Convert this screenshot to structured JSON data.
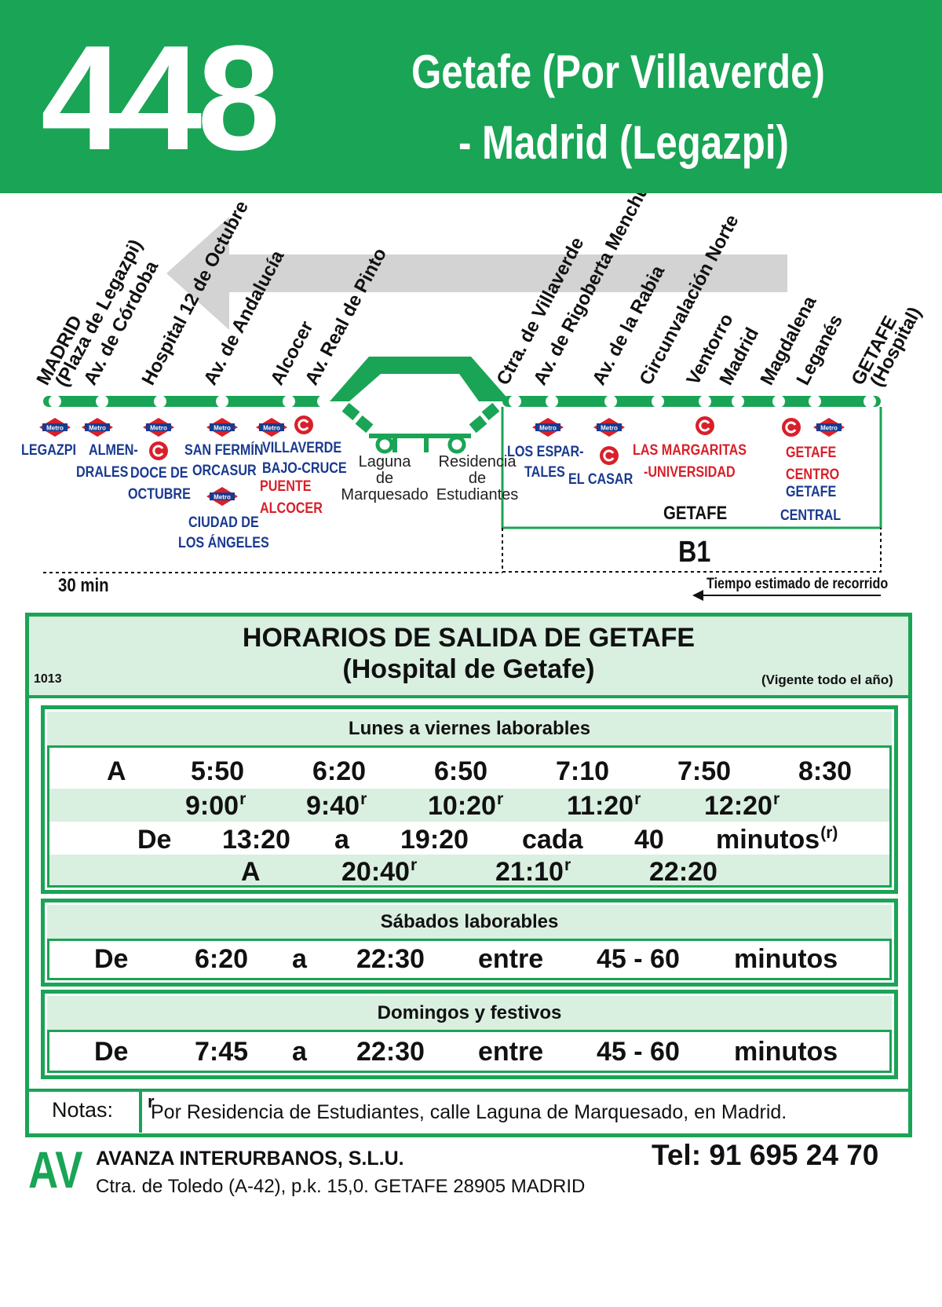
{
  "header": {
    "route_number": "448",
    "route_name_line1": "Getafe (Por Villaverde)",
    "route_name_line2": "- Madrid (Legazpi)"
  },
  "map": {
    "stops": [
      {
        "label": "MADRID",
        "sub": "(Plaza de Legazpi)"
      },
      {
        "label": "Av. de Córdoba"
      },
      {
        "label": "Hospital 12 de Octubre"
      },
      {
        "label": "Av. de Andalucía"
      },
      {
        "label": "Alcocer"
      },
      {
        "label": "Av. Real de Pinto"
      },
      {
        "label": "Ctra. de Villaverde"
      },
      {
        "label": "Av. de Rigoberta Menchú"
      },
      {
        "label": "Av. de la Rabia"
      },
      {
        "label": "Circunvalación Norte"
      },
      {
        "label": "Ventorro"
      },
      {
        "label": "Madrid"
      },
      {
        "label": "Magdalena"
      },
      {
        "label": "Leganés"
      },
      {
        "label": "GETAFE",
        "sub": "(Hospital)"
      }
    ],
    "connections": {
      "legazpi": "LEGAZPI",
      "almendrales_1": "ALMEN-",
      "almendrales_2": "DRALES",
      "doce_1": "DOCE DE",
      "doce_2": "OCTUBRE",
      "san_fermin_1": "SAN FERMÍN",
      "san_fermin_2": "ORCASUR",
      "ciudad_1": "CIUDAD DE",
      "ciudad_2": "LOS ÁNGELES",
      "villaverde_1": "VILLAVERDE",
      "villaverde_2": "BAJO-CRUCE",
      "puente_1": "PUENTE",
      "puente_2": "ALCOCER",
      "laguna": [
        "Laguna",
        "de",
        "Marquesado"
      ],
      "residencia": [
        "Residencia",
        "de",
        "Estudiantes"
      ],
      "espartales_1": "LOS ESPAR-",
      "espartales_2": "TALES",
      "el_casar": "EL CASAR",
      "margaritas_1": "LAS MARGARITAS",
      "margaritas_2": "-UNIVERSIDAD",
      "getafe_zone": "GETAFE",
      "getafe_centro_1": "GETAFE",
      "getafe_centro_2": "CENTRO",
      "getafe_central_1": "GETAFE",
      "getafe_central_2": "CENTRAL",
      "b1": "B1",
      "metro_badge": "Metro"
    },
    "travel_time": "30 min",
    "travel_time_caption": "Tiempo estimado de recorrido"
  },
  "schedule": {
    "title_line1": "HORARIOS DE SALIDA DE GETAFE",
    "title_line2": "(Hospital de Getafe)",
    "code": "1013",
    "validity": "(Vigente todo el año)",
    "weekdays": {
      "title": "Lunes a viernes laborables",
      "row1": [
        "A",
        "5:50",
        "6:20",
        "6:50",
        "7:10",
        "7:50",
        "8:30"
      ],
      "row2": [
        "9:00",
        "9:40",
        "10:20",
        "11:20",
        "12:20"
      ],
      "row3": [
        "De",
        "13:20",
        "a",
        "19:20",
        "cada",
        "40",
        "minutos"
      ],
      "row4": [
        "A",
        "20:40",
        "21:10",
        "22:20"
      ],
      "sup_r": "r",
      "sup_paren_r": "(r)"
    },
    "saturdays": {
      "title": "Sábados laborables",
      "row": [
        "De",
        "6:20",
        "a",
        "22:30",
        "entre",
        "45 - 60",
        "minutos"
      ]
    },
    "sundays": {
      "title": "Domingos y festivos",
      "row": [
        "De",
        "7:45",
        "a",
        "22:30",
        "entre",
        "45 - 60",
        "minutos"
      ]
    },
    "notes_label": "Notas:",
    "notes_mark": "r",
    "notes_text": "Por Residencia de Estudiantes, calle Laguna de Marquesado, en Madrid."
  },
  "footer": {
    "logo": "AV",
    "company": "AVANZA INTERURBANOS, S.L.U.",
    "address": "Ctra. de Toledo (A-42), p.k. 15,0. GETAFE 28905 MADRID",
    "tel": "Tel: 91 695 24 70"
  },
  "colors": {
    "brand_green": "#1aa455",
    "light_green": "#d9efe0",
    "metro_red": "#d8202a",
    "metro_blue": "#1a3a8f",
    "arrow_gray": "#d3d3d3"
  }
}
